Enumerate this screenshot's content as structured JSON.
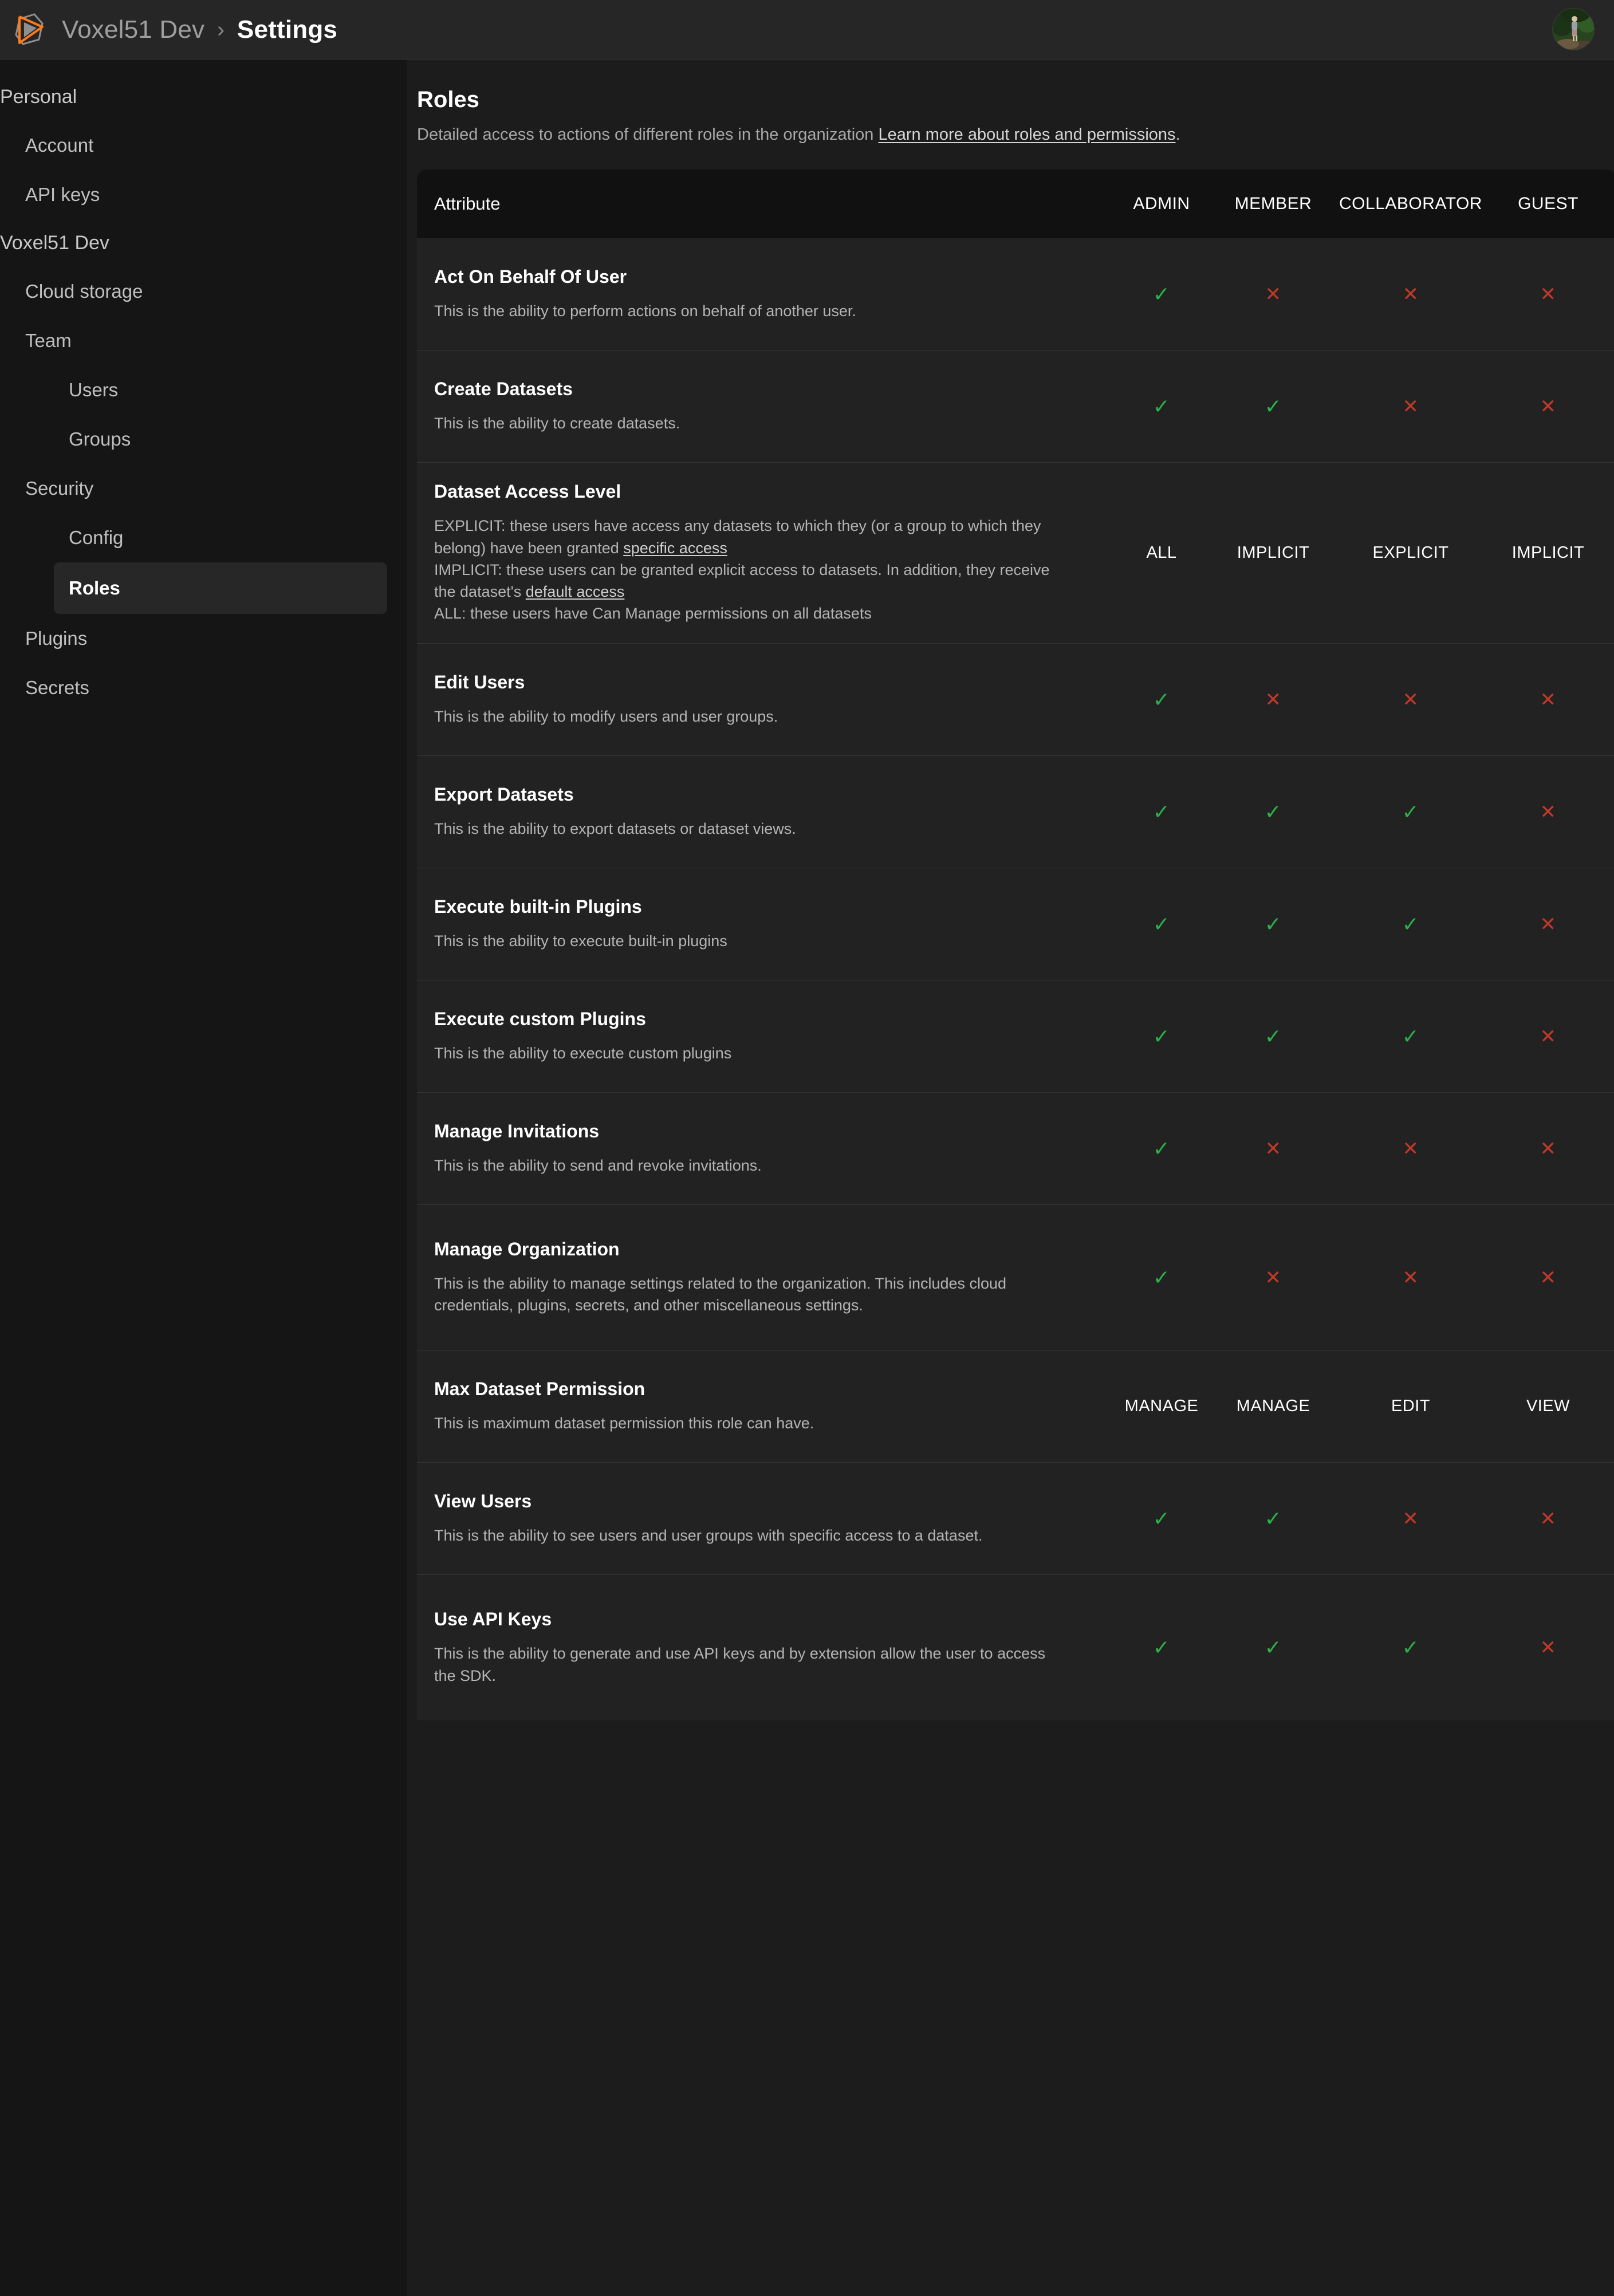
{
  "topbar": {
    "logo_icon": "voxel51-logo-icon",
    "org_name": "Voxel51 Dev",
    "separator": "›",
    "page": "Settings",
    "avatar_icon": "user-avatar"
  },
  "sidebar": {
    "sections": [
      {
        "label": "Personal",
        "items": [
          {
            "label": "Account",
            "level": 1,
            "active": false
          },
          {
            "label": "API keys",
            "level": 1,
            "active": false
          }
        ]
      },
      {
        "label": "Voxel51 Dev",
        "items": [
          {
            "label": "Cloud storage",
            "level": 1,
            "active": false
          },
          {
            "label": "Team",
            "level": 1,
            "active": false
          },
          {
            "label": "Users",
            "level": 2,
            "active": false
          },
          {
            "label": "Groups",
            "level": 2,
            "active": false
          },
          {
            "label": "Security",
            "level": 1,
            "active": false
          },
          {
            "label": "Config",
            "level": 2,
            "active": false
          },
          {
            "label": "Roles",
            "level": 2,
            "active": true
          },
          {
            "label": "Plugins",
            "level": 1,
            "active": false
          },
          {
            "label": "Secrets",
            "level": 1,
            "active": false
          }
        ]
      }
    ]
  },
  "main": {
    "title": "Roles",
    "subtitle_text": "Detailed access to actions of different roles in the organization ",
    "subtitle_link": "Learn more about roles and permissions",
    "subtitle_tail": ".",
    "colors": {
      "yes": "#2bb14a",
      "no": "#c0392b",
      "accent": "#ff7a19",
      "panel": "#222222",
      "header": "#111111",
      "sidebar": "#151515"
    },
    "table": {
      "columns": [
        "Attribute",
        "ADMIN",
        "MEMBER",
        "COLLABORATOR",
        "GUEST"
      ],
      "yes_glyph": "✓",
      "no_glyph": "✕",
      "rows": [
        {
          "title": "Act On Behalf Of User",
          "desc": "This is the ability to perform actions on behalf of another user.",
          "values": [
            "yes",
            "no",
            "no",
            "no"
          ],
          "height": "r-h1"
        },
        {
          "title": "Create Datasets",
          "desc": "This is the ability to create datasets.",
          "values": [
            "yes",
            "yes",
            "no",
            "no"
          ],
          "height": "r-h1"
        },
        {
          "title": "Dataset Access Level",
          "desc": "EXPLICIT: these users have access any datasets to which they (or a group to which they belong) have been granted specific access\nIMPLICIT: these users can be granted explicit access to datasets. In addition, they receive the dataset's default access\nALL: these users have Can Manage permissions on all datasets",
          "desc_links": [
            "specific access",
            "default access"
          ],
          "values": [
            "ALL",
            "IMPLICIT",
            "EXPLICIT",
            "IMPLICIT"
          ],
          "height": "r-h3"
        },
        {
          "title": "Edit Users",
          "desc": "This is the ability to modify users and user groups.",
          "values": [
            "yes",
            "no",
            "no",
            "no"
          ],
          "height": "r-h1"
        },
        {
          "title": "Export Datasets",
          "desc": "This is the ability to export datasets or dataset views.",
          "values": [
            "yes",
            "yes",
            "yes",
            "no"
          ],
          "height": "r-h1"
        },
        {
          "title": "Execute built-in Plugins",
          "desc": "This is the ability to execute built-in plugins",
          "values": [
            "yes",
            "yes",
            "yes",
            "no"
          ],
          "height": "r-h1"
        },
        {
          "title": "Execute custom Plugins",
          "desc": "This is the ability to execute custom plugins",
          "values": [
            "yes",
            "yes",
            "yes",
            "no"
          ],
          "height": "r-h1"
        },
        {
          "title": "Manage Invitations",
          "desc": "This is the ability to send and revoke invitations.",
          "values": [
            "yes",
            "no",
            "no",
            "no"
          ],
          "height": "r-h1"
        },
        {
          "title": "Manage Organization",
          "desc": "This is the ability to manage settings related to the organization. This includes cloud credentials, plugins, secrets, and other miscellaneous settings.",
          "values": [
            "yes",
            "no",
            "no",
            "no"
          ],
          "height": "r-h2"
        },
        {
          "title": "Max Dataset Permission",
          "desc": "This is maximum dataset permission this role can have.",
          "values": [
            "MANAGE",
            "MANAGE",
            "EDIT",
            "VIEW"
          ],
          "height": "r-h1"
        },
        {
          "title": "View Users",
          "desc": "This is the ability to see users and user groups with specific access to a dataset.",
          "values": [
            "yes",
            "yes",
            "no",
            "no"
          ],
          "height": "r-h1"
        },
        {
          "title": "Use API Keys",
          "desc": "This is the ability to generate and use API keys and by extension allow the user to access the SDK.",
          "values": [
            "yes",
            "yes",
            "yes",
            "no"
          ],
          "height": "r-h2"
        }
      ]
    }
  }
}
